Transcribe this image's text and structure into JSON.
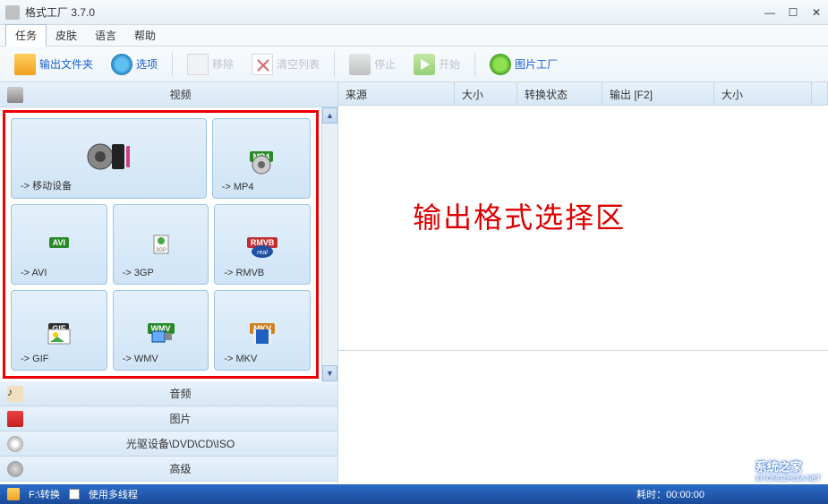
{
  "window": {
    "title": "格式工厂 3.7.0"
  },
  "menu": {
    "items": [
      "任务",
      "皮肤",
      "语言",
      "帮助"
    ]
  },
  "toolbar": {
    "output_folder": "输出文件夹",
    "options": "选项",
    "remove": "移除",
    "clear_list": "清空列表",
    "stop": "停止",
    "start": "开始",
    "photo_factory": "图片工厂"
  },
  "categories": {
    "video": "视频",
    "audio": "音频",
    "picture": "图片",
    "disc": "光驱设备\\DVD\\CD\\ISO",
    "advanced": "高级"
  },
  "formats": {
    "mobile": "-> 移动设备",
    "mp4": "-> MP4",
    "avi": "-> AVI",
    "3gp": "-> 3GP",
    "rmvb": "-> RMVB",
    "gif": "-> GIF",
    "wmv": "-> WMV",
    "mkv": "-> MKV"
  },
  "task_columns": {
    "source": "来源",
    "size1": "大小",
    "status": "转换状态",
    "output": "输出 [F2]",
    "size2": "大小"
  },
  "overlay": "输出格式选择区",
  "statusbar": {
    "path": "F:\\转换",
    "multithread": "使用多线程",
    "elapsed": "耗时：00:00:00"
  },
  "watermark": "系统之家",
  "watermark_url": "XITONGZHIJIA.NET",
  "icon_badges": {
    "mp4": "MP4",
    "avi": "AVI",
    "rmvb": "RMVB",
    "gif": "GIF",
    "wmv": "WMV",
    "mkv": "MKV",
    "3gp": "3GP"
  }
}
